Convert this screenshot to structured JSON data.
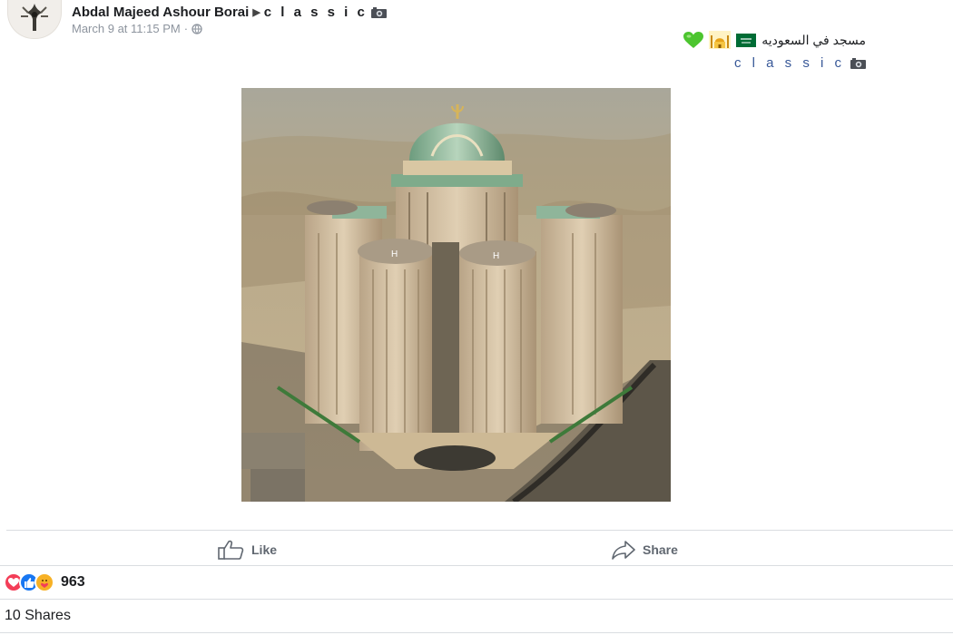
{
  "post": {
    "author": "Abdal Majeed Ashour Borai",
    "group": "c l a s s i c",
    "timestamp": "March 9 at 11:15 PM",
    "separator": "·",
    "text_arabic": "مسجد في السعوديه",
    "text_classic": "c l a s s i c"
  },
  "actions": {
    "like_label": "Like",
    "share_label": "Share"
  },
  "stats": {
    "reaction_count": "963",
    "shares_label": "10 Shares"
  },
  "icons": {
    "avatar": "avatar-image",
    "camera": "camera-icon",
    "globe": "globe-icon",
    "flag": "saudi-flag-icon",
    "mosque": "mosque-icon",
    "heart": "green-heart-icon",
    "like": "thumbs-up-icon",
    "share": "share-arrow-icon",
    "reactions": [
      "love-reaction-icon",
      "like-reaction-icon",
      "care-reaction-icon"
    ]
  },
  "colors": {
    "link": "#385898",
    "muted": "#8d949e",
    "action": "#606770",
    "love": "#f33e58",
    "like": "#1877f2",
    "care": "#f7b125",
    "flag": "#006c35",
    "heart": "#4cc52f"
  }
}
